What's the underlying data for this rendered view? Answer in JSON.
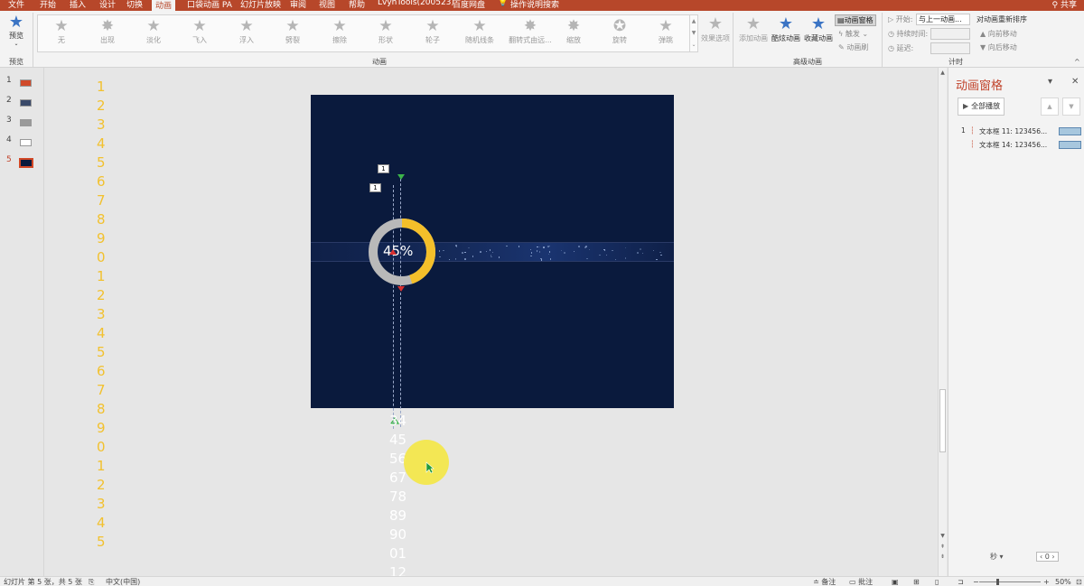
{
  "tabs": [
    {
      "label": "文件",
      "active": false
    },
    {
      "label": "开始",
      "active": false
    },
    {
      "label": "插入",
      "active": false
    },
    {
      "label": "设计",
      "active": false
    },
    {
      "label": "切换",
      "active": false
    },
    {
      "label": "动画",
      "active": true
    },
    {
      "label": "口袋动画 PA",
      "active": false
    },
    {
      "label": "幻灯片放映",
      "active": false
    },
    {
      "label": "审阅",
      "active": false
    },
    {
      "label": "视图",
      "active": false
    },
    {
      "label": "帮助",
      "active": false
    },
    {
      "label": "LvyhTools(200523)",
      "active": false
    },
    {
      "label": "百度网盘",
      "active": false
    },
    {
      "label": "操作说明搜索",
      "active": false
    }
  ],
  "share_label": "共享",
  "ribbon": {
    "preview_label": "预览",
    "group_preview": "预览",
    "group_animation": "动画",
    "group_advanced": "高级动画",
    "group_timing": "计时",
    "gallery": [
      "无",
      "出现",
      "淡化",
      "飞入",
      "浮入",
      "劈裂",
      "擦除",
      "形状",
      "轮子",
      "随机线条",
      "翻转式由远...",
      "缩放",
      "旋转",
      "弹跳"
    ],
    "effect_options": "效果选项",
    "add_animation": "添加动画",
    "brush_animation": "酷炫动画",
    "collect_animation": "收藏动画",
    "anim_pane_btn": "动画窗格",
    "trigger": "触发",
    "anim_painter": "动画刷",
    "start_label": "开始:",
    "start_value": "与上一动画...",
    "duration_label": "持续时间:",
    "delay_label": "延迟:",
    "reorder_title": "对动画重新排序",
    "move_earlier": "向前移动",
    "move_later": "向后移动"
  },
  "slides": [
    {
      "num": "1",
      "selected": false,
      "color": "#d04a2a"
    },
    {
      "num": "2",
      "selected": false,
      "color": "#3a4a6a"
    },
    {
      "num": "3",
      "selected": false,
      "color": "#9a9a9a"
    },
    {
      "num": "4",
      "selected": false,
      "color": "#ffffff"
    },
    {
      "num": "5",
      "selected": true,
      "color": "#0a1a3d"
    }
  ],
  "canvas": {
    "digits": [
      "1",
      "2",
      "3",
      "4",
      "5",
      "6",
      "7",
      "8",
      "9",
      "0",
      "1",
      "2",
      "3",
      "4",
      "5",
      "6",
      "7",
      "8",
      "9",
      "0",
      "1",
      "2",
      "3",
      "4",
      "5"
    ],
    "ring_percent": 45,
    "ring_label": "45%",
    "tag1": "1",
    "tag2": "1",
    "overflow_numbers": [
      "34",
      "45",
      "56",
      "67",
      "78",
      "89",
      "90",
      "01",
      "12"
    ]
  },
  "pane": {
    "title": "动画窗格",
    "play_all": "全部播放",
    "items": [
      {
        "num": "1",
        "label": "文本框 11: 123456..."
      },
      {
        "num": "",
        "label": "文本框 14: 123456..."
      }
    ],
    "seconds_label": "秒",
    "page_value": "0"
  },
  "status": {
    "slide_info": "幻灯片 第 5 张，共 5 张",
    "language": "中文(中国)",
    "notes": "备注",
    "comments": "批注",
    "zoom": "50%"
  }
}
